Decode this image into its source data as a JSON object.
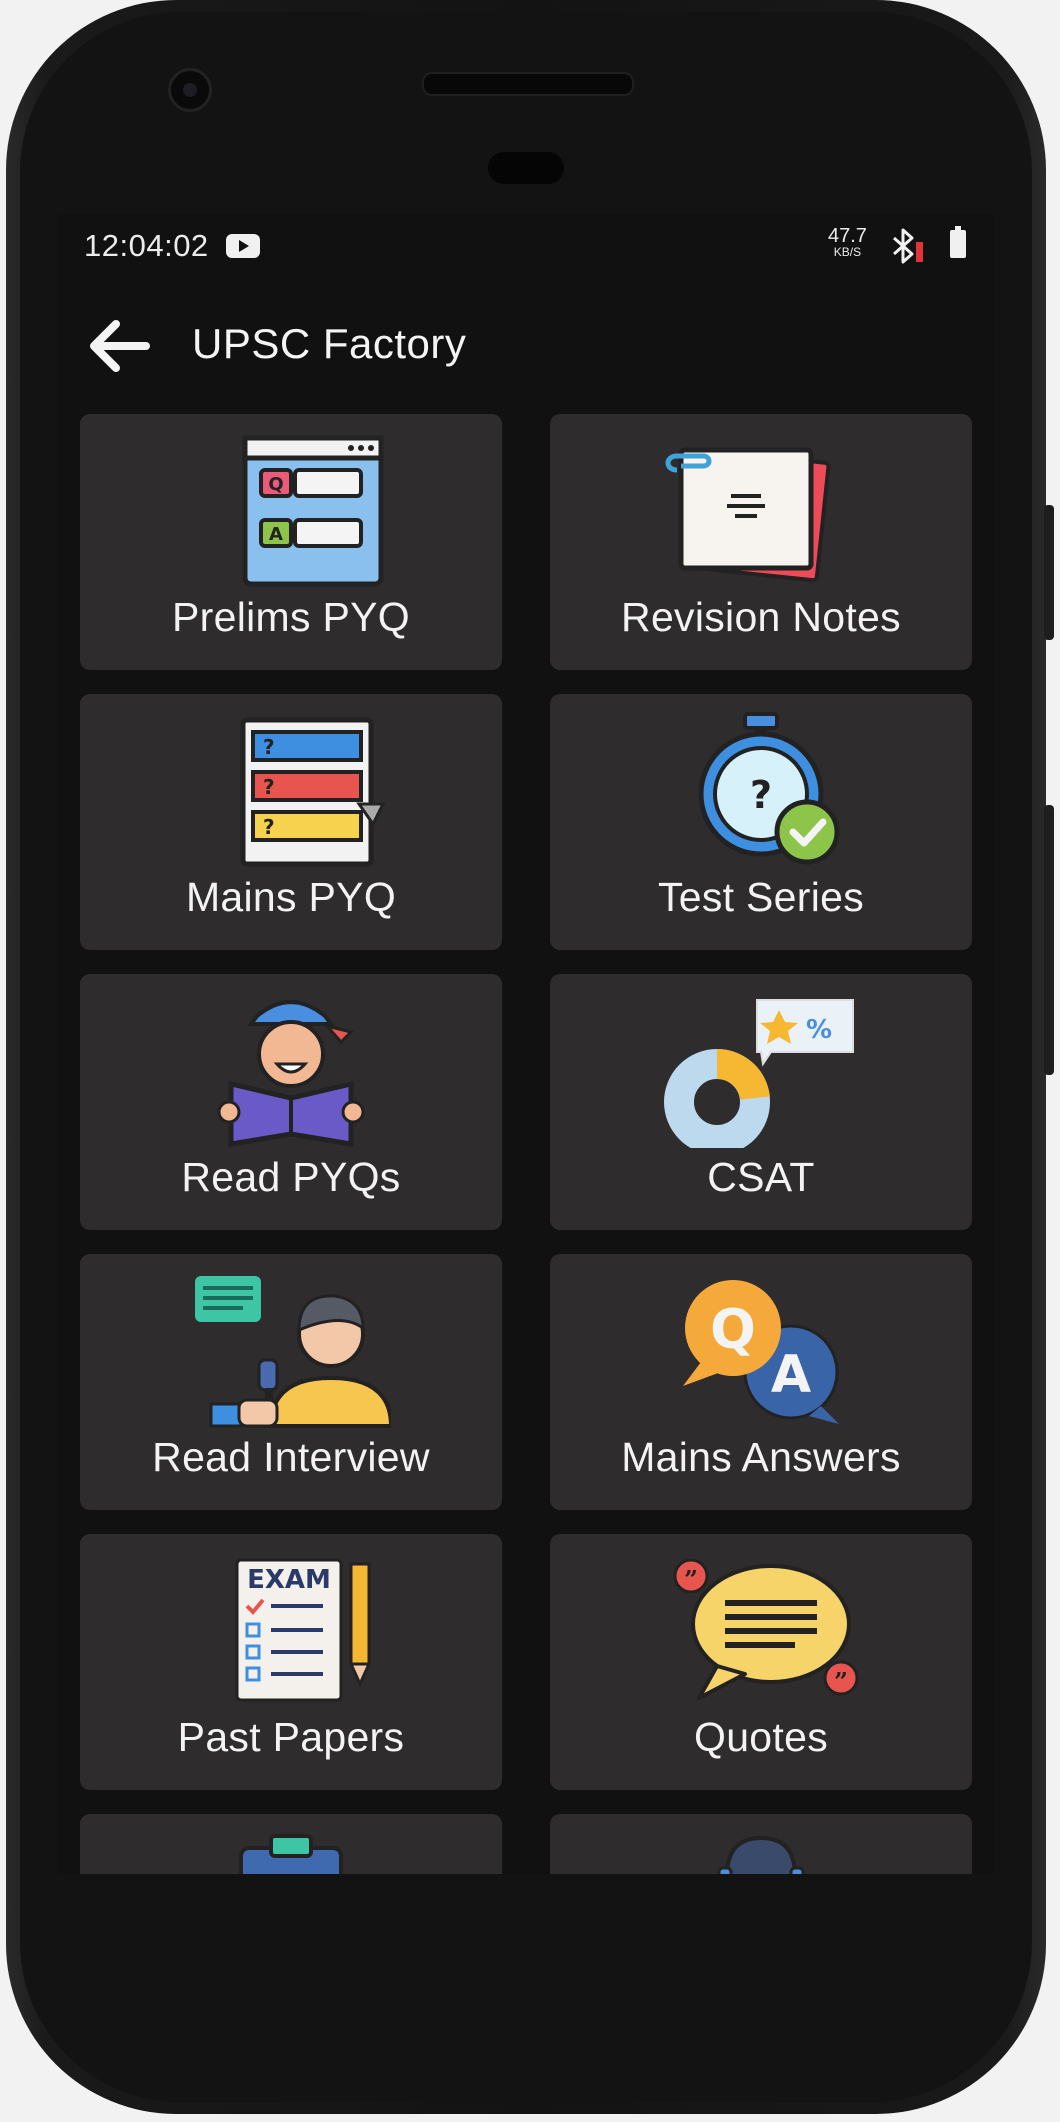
{
  "status_bar": {
    "time": "12:04:02",
    "net_speed_value": "47.7",
    "net_speed_unit": "KB/S",
    "icons": [
      "youtube-icon",
      "bluetooth-icon",
      "battery-icon"
    ]
  },
  "toolbar": {
    "title": "UPSC Factory",
    "back_icon": "arrow-left-icon"
  },
  "colors": {
    "background": "#111111",
    "tile": "#2e2c2c",
    "text": "#f3f3f3"
  },
  "tiles": [
    {
      "label": "Prelims PYQ",
      "icon": "qa-document-icon"
    },
    {
      "label": "Revision Notes",
      "icon": "notes-paperclip-icon"
    },
    {
      "label": "Mains PYQ",
      "icon": "question-list-icon"
    },
    {
      "label": "Test Series",
      "icon": "stopwatch-check-icon"
    },
    {
      "label": "Read PYQs",
      "icon": "reading-person-icon"
    },
    {
      "label": "CSAT",
      "icon": "donut-chart-icon"
    },
    {
      "label": "Read Interview",
      "icon": "interview-person-icon"
    },
    {
      "label": "Mains Answers",
      "icon": "qa-bubbles-icon"
    },
    {
      "label": "Past Papers",
      "icon": "exam-paper-icon"
    },
    {
      "label": "Quotes",
      "icon": "quote-bubble-icon"
    }
  ]
}
